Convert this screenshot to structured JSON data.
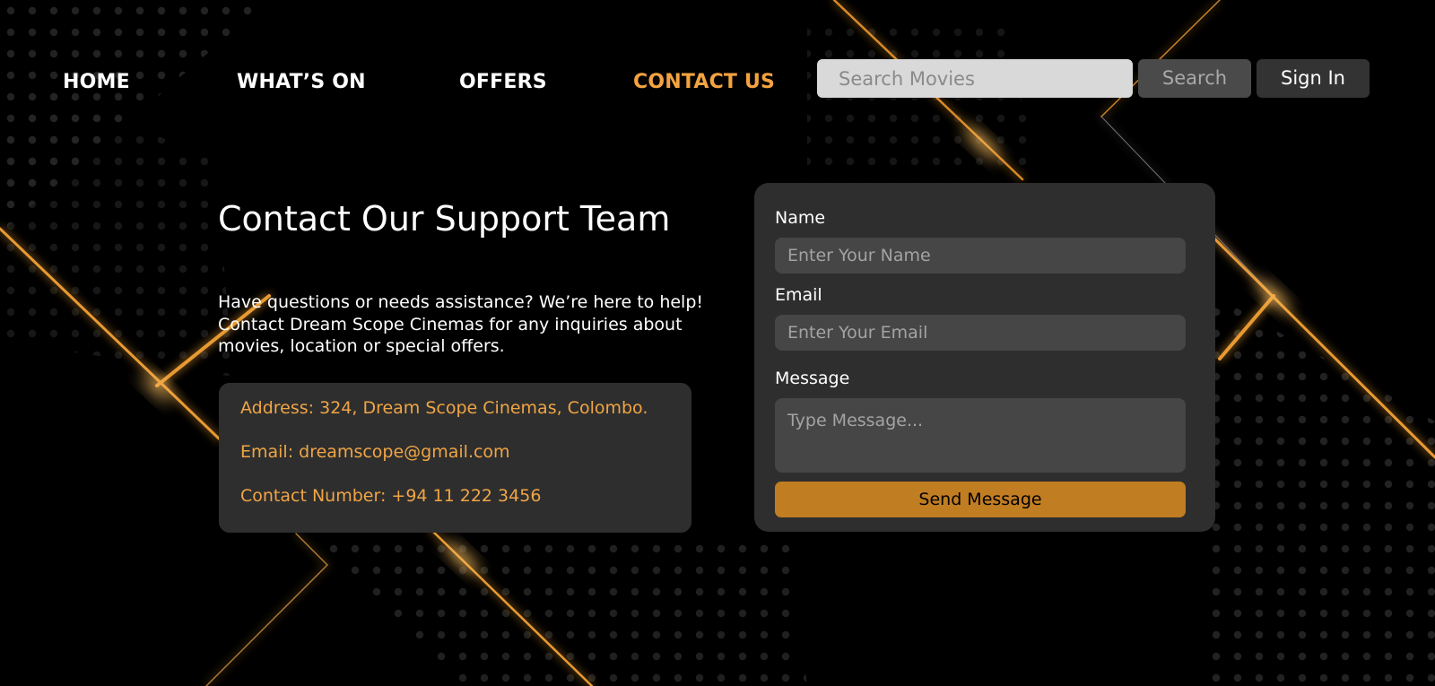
{
  "colors": {
    "background": "#000000",
    "accent": "#f4a340",
    "card": "#2e2e2e",
    "send_button": "#c17d22"
  },
  "nav": {
    "items": [
      {
        "label": "HOME",
        "active": false
      },
      {
        "label": "WHAT’S ON",
        "active": false
      },
      {
        "label": "OFFERS",
        "active": false
      },
      {
        "label": "CONTACT US",
        "active": true
      }
    ],
    "search_placeholder": "Search Movies",
    "search_button": "Search",
    "signin_button": "Sign In"
  },
  "main": {
    "title": "Contact Our Support Team",
    "intro": "Have questions or needs assistance? We’re here to help! Contact Dream Scope Cinemas for any inquiries about movies, location or special offers.",
    "info": {
      "address": "Address: 324, Dream Scope Cinemas, Colombo.",
      "email": "Email: dreamscope@gmail.com",
      "phone": "Contact Number: +94 11 222 3456"
    }
  },
  "form": {
    "name_label": "Name",
    "name_placeholder": "Enter Your Name",
    "email_label": "Email",
    "email_placeholder": "Enter Your Email",
    "message_label": "Message",
    "message_placeholder": "Type Message...",
    "send_button": "Send Message"
  }
}
